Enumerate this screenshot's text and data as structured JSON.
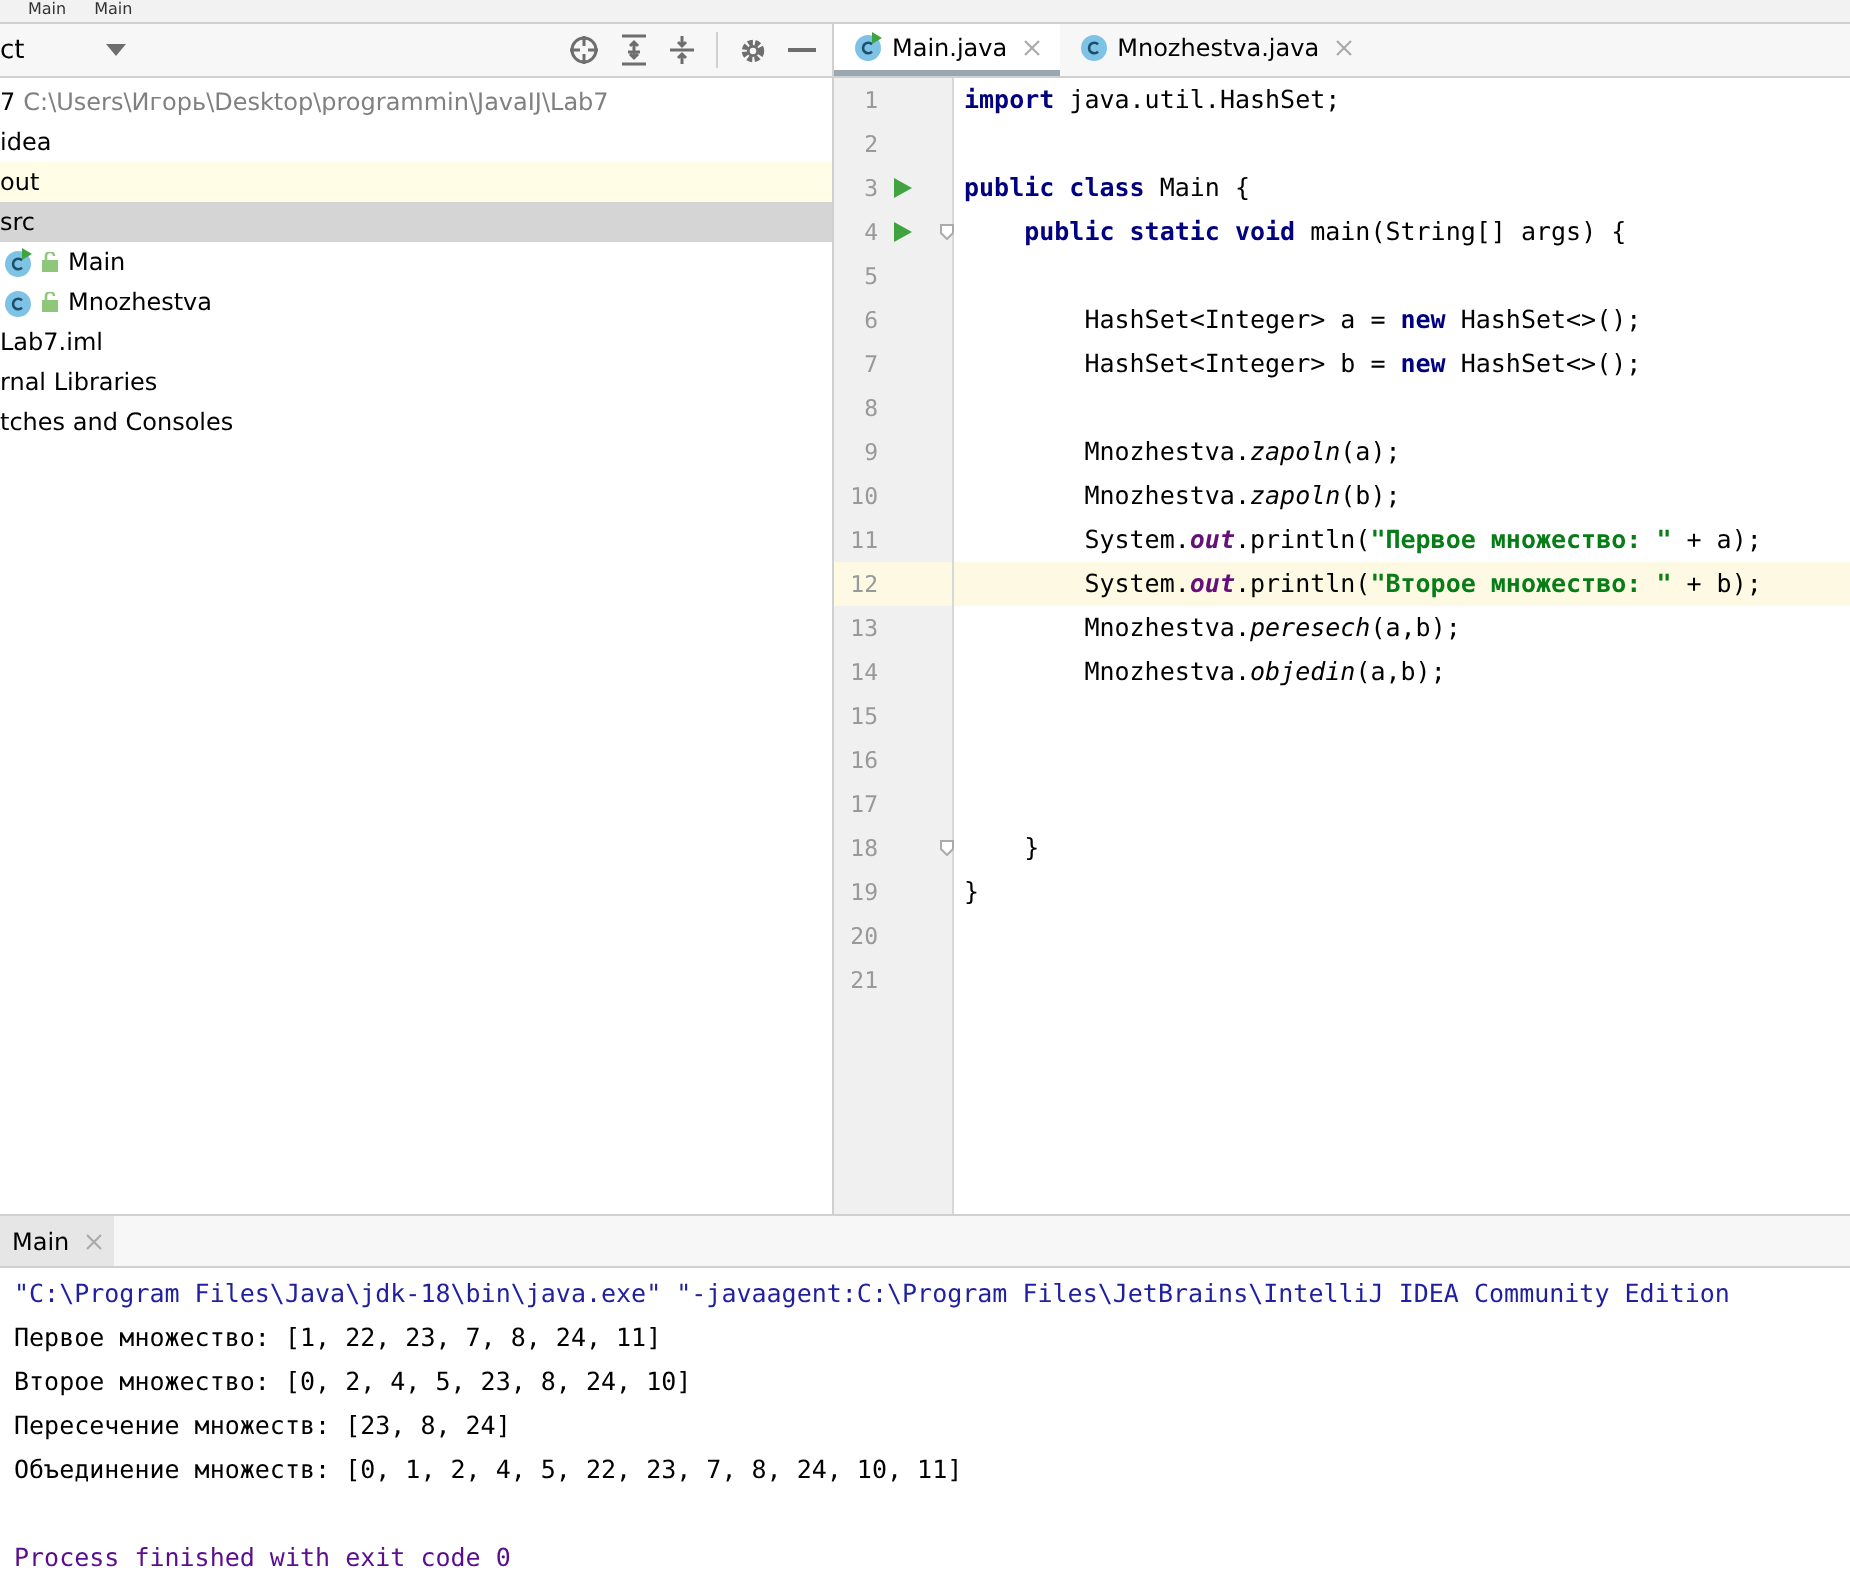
{
  "breadcrumb": [
    "Main",
    "Main"
  ],
  "project": {
    "title": "ct",
    "items": [
      {
        "label": "7",
        "path": "C:\\Users\\Игорь\\Desktop\\programmin\\JavaIJ\\Lab7",
        "selected": false,
        "excluded": false
      },
      {
        "label": "idea",
        "selected": false,
        "excluded": false
      },
      {
        "label": "out",
        "selected": false,
        "excluded": true
      },
      {
        "label": "src",
        "selected": true,
        "excluded": false,
        "children": [
          {
            "label": "Main",
            "kind": "main-class",
            "selected": false,
            "excluded": false
          },
          {
            "label": "Mnozhestva",
            "kind": "class",
            "selected": false,
            "excluded": false
          }
        ]
      },
      {
        "label": "Lab7.iml",
        "selected": false,
        "excluded": false
      },
      {
        "label": "rnal Libraries",
        "selected": false,
        "excluded": false
      },
      {
        "label": "tches and Consoles",
        "selected": false,
        "excluded": false
      }
    ]
  },
  "editor": {
    "tabs": [
      {
        "label": "Main.java",
        "kind": "main-class",
        "selected": true
      },
      {
        "label": "Mnozhestva.java",
        "kind": "class",
        "selected": false
      }
    ],
    "lines": [
      {
        "number": "1",
        "run": false,
        "fold": false,
        "current": false,
        "tokens": [
          {
            "kind": "keyword",
            "text": "import"
          },
          {
            "kind": "plain",
            "text": " java.util.HashSet;"
          }
        ]
      },
      {
        "number": "2",
        "run": false,
        "fold": false,
        "current": false
      },
      {
        "number": "3",
        "run": true,
        "fold": false,
        "current": false,
        "tokens": [
          {
            "kind": "keyword",
            "text": "public class"
          },
          {
            "kind": "plain",
            "text": " Main {"
          }
        ]
      },
      {
        "number": "4",
        "run": true,
        "fold": true,
        "current": false,
        "tokens": [
          {
            "kind": "keyword",
            "text": "    public static void"
          },
          {
            "kind": "plain",
            "text": " main(String[] args) {"
          }
        ]
      },
      {
        "number": "5",
        "run": false,
        "fold": false,
        "current": false
      },
      {
        "number": "6",
        "run": false,
        "fold": false,
        "current": false,
        "tokens": [
          {
            "kind": "plain",
            "text": "        HashSet<Integer> a = "
          },
          {
            "kind": "keyword",
            "text": "new"
          },
          {
            "kind": "plain",
            "text": " HashSet<>();"
          }
        ]
      },
      {
        "number": "7",
        "run": false,
        "fold": false,
        "current": false,
        "tokens": [
          {
            "kind": "plain",
            "text": "        HashSet<Integer> b = "
          },
          {
            "kind": "keyword",
            "text": "new"
          },
          {
            "kind": "plain",
            "text": " HashSet<>();"
          }
        ]
      },
      {
        "number": "8",
        "run": false,
        "fold": false,
        "current": false
      },
      {
        "number": "9",
        "run": false,
        "fold": false,
        "current": false,
        "tokens": [
          {
            "kind": "plain",
            "text": "        Mnozhestva."
          },
          {
            "kind": "method",
            "text": "zapoln"
          },
          {
            "kind": "plain",
            "text": "(a);"
          }
        ]
      },
      {
        "number": "10",
        "run": false,
        "fold": false,
        "current": false,
        "tokens": [
          {
            "kind": "plain",
            "text": "        Mnozhestva."
          },
          {
            "kind": "method",
            "text": "zapoln"
          },
          {
            "kind": "plain",
            "text": "(b);"
          }
        ]
      },
      {
        "number": "11",
        "run": false,
        "fold": false,
        "current": false,
        "tokens": [
          {
            "kind": "plain",
            "text": "        System."
          },
          {
            "kind": "field",
            "text": "out"
          },
          {
            "kind": "plain",
            "text": ".println("
          },
          {
            "kind": "string",
            "text": "\"Первое множество: \""
          },
          {
            "kind": "plain",
            "text": " + a);"
          }
        ]
      },
      {
        "number": "12",
        "run": false,
        "fold": false,
        "current": true,
        "tokens": [
          {
            "kind": "plain",
            "text": "        System."
          },
          {
            "kind": "field",
            "text": "out"
          },
          {
            "kind": "plain",
            "text": ".println("
          },
          {
            "kind": "string",
            "text": "\"Второе множество: \""
          },
          {
            "kind": "plain",
            "text": " + b);"
          }
        ]
      },
      {
        "number": "13",
        "run": false,
        "fold": false,
        "current": false,
        "tokens": [
          {
            "kind": "plain",
            "text": "        Mnozhestva."
          },
          {
            "kind": "method",
            "text": "peresech"
          },
          {
            "kind": "plain",
            "text": "(a,b);"
          }
        ]
      },
      {
        "number": "14",
        "run": false,
        "fold": false,
        "current": false,
        "tokens": [
          {
            "kind": "plain",
            "text": "        Mnozhestva."
          },
          {
            "kind": "method",
            "text": "objedin"
          },
          {
            "kind": "plain",
            "text": "(a,b);"
          }
        ]
      },
      {
        "number": "15",
        "run": false,
        "fold": false,
        "current": false
      },
      {
        "number": "16",
        "run": false,
        "fold": false,
        "current": false
      },
      {
        "number": "17",
        "run": false,
        "fold": false,
        "current": false
      },
      {
        "number": "18",
        "run": false,
        "fold": true,
        "current": false,
        "tokens": [
          {
            "kind": "plain",
            "text": "    }"
          }
        ]
      },
      {
        "number": "19",
        "run": false,
        "fold": false,
        "current": false,
        "tokens": [
          {
            "kind": "plain",
            "text": "}"
          }
        ]
      },
      {
        "number": "20",
        "run": false,
        "fold": false,
        "current": false
      },
      {
        "number": "21",
        "run": false,
        "fold": false,
        "current": false
      }
    ]
  },
  "run": {
    "tabs": [
      {
        "label": "Main",
        "selected": true
      }
    ],
    "lines": [
      {
        "kind": "command",
        "text": "\"C:\\Program Files\\Java\\jdk-18\\bin\\java.exe\" \"-javaagent:C:\\Program Files\\JetBrains\\IntelliJ IDEA Community Edition"
      },
      {
        "kind": "output",
        "text": "Первое множество: [1, 22, 23, 7, 8, 24, 11]"
      },
      {
        "kind": "output",
        "text": "Второе множество: [0, 2, 4, 5, 23, 8, 24, 10]"
      },
      {
        "kind": "output",
        "text": "Пересечение множеств: [23, 8, 24]"
      },
      {
        "kind": "output",
        "text": "Объединение множеств: [0, 1, 2, 4, 5, 22, 23, 7, 8, 24, 10, 11]"
      },
      {
        "kind": "blank"
      },
      {
        "kind": "exit",
        "text": "Process finished with exit code 0"
      }
    ]
  }
}
